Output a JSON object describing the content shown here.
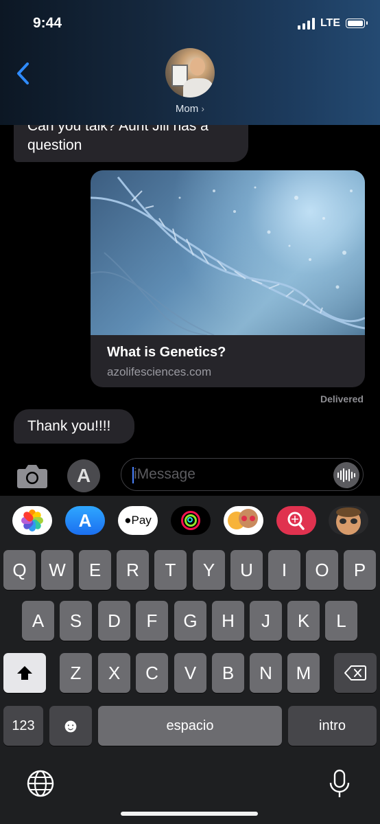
{
  "status_bar": {
    "time": "9:44",
    "network": "LTE"
  },
  "header": {
    "contact_name": "Mom",
    "chevron": "›"
  },
  "messages": {
    "first": "Can you talk? Aunt Jill has a question",
    "link": {
      "title": "What is Genetics?",
      "domain": "azolifesciences.com"
    },
    "delivered_label": "Delivered",
    "second": "Thank you!!!!"
  },
  "composer": {
    "placeholder": "iMessage",
    "apps_glyph": "A"
  },
  "app_strip": {
    "pay_label": "Pay",
    "store_glyph": "A"
  },
  "keyboard": {
    "row1": [
      "Q",
      "W",
      "E",
      "R",
      "T",
      "Y",
      "U",
      "I",
      "O",
      "P"
    ],
    "row2": [
      "A",
      "S",
      "D",
      "F",
      "G",
      "H",
      "J",
      "K",
      "L"
    ],
    "row3": [
      "Z",
      "X",
      "C",
      "V",
      "B",
      "N",
      "M"
    ],
    "numbers_key": "123",
    "space_key": "espacio",
    "return_key": "intro",
    "emoji_glyph": "☻",
    "delete_glyph": "⌫"
  },
  "icons": [
    "back-chevron",
    "camera",
    "app-store",
    "audio-waveform",
    "globe",
    "microphone",
    "shift",
    "delete",
    "emoji",
    "photos",
    "apple-pay",
    "activity",
    "memoji",
    "image-search"
  ]
}
